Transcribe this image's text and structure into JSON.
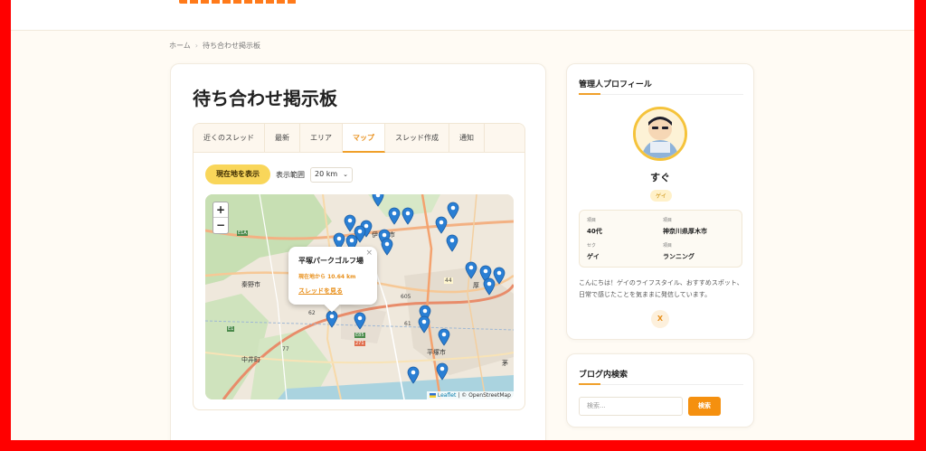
{
  "breadcrumb": {
    "home": "ホーム",
    "separator": "›",
    "current": "待ち合わせ掲示板"
  },
  "page": {
    "title": "待ち合わせ掲示板"
  },
  "tabs": [
    {
      "label": "近くのスレッド",
      "active": false
    },
    {
      "label": "最新",
      "active": false
    },
    {
      "label": "エリア",
      "active": false
    },
    {
      "label": "マップ",
      "active": true
    },
    {
      "label": "スレッド作成",
      "active": false
    },
    {
      "label": "通知",
      "active": false
    }
  ],
  "controls": {
    "show_location": "現在地を表示",
    "range_label": "表示範囲",
    "range_value": "20 km"
  },
  "map": {
    "zoom_in": "+",
    "zoom_out": "−",
    "labels": {
      "hadano": "秦野市",
      "nakai": "中井町",
      "hiratsuka": "平塚市",
      "road_605": "605",
      "road_44": "44",
      "road_62": "62",
      "road_61": "61",
      "road_e85": "E85",
      "road_271": "271",
      "road_e1a": "E1A",
      "road_77": "77",
      "road_e1": "E1",
      "road_63": "63",
      "isehara_fragment": "伊",
      "isehara_fragment2": "市",
      "atsugi_fragment": "厚",
      "chigasaki_fragment": "茅"
    },
    "popup": {
      "title": "平塚パークゴルフ場",
      "distance": "現在地から 10.64 km",
      "link": "スレッドを見る",
      "close": "×"
    },
    "attribution": {
      "leaflet": "Leaflet",
      "rest": "| © OpenStreetMap"
    },
    "marker_color": "#2a7fd4"
  },
  "profile": {
    "heading": "管理人プロフィール",
    "name": "すぐ",
    "badge": "ゲイ",
    "info": [
      {
        "key": "項目",
        "value": "40代"
      },
      {
        "key": "項目",
        "value": "神奈川県厚木市"
      },
      {
        "key": "セク",
        "value": "ゲイ"
      },
      {
        "key": "項目",
        "value": "ランニング"
      }
    ],
    "bio": "こんにちは！ゲイのライフスタイル、おすすめスポット、日常で感じたことを気ままに発信しています。",
    "social": "X"
  },
  "search": {
    "heading": "ブログ内検索",
    "placeholder": "検索...",
    "button": "検索"
  },
  "colors": {
    "accent": "#f0a02a",
    "button_yellow": "#f9d65a",
    "search_orange": "#f5900f",
    "frame_red": "#ff0000"
  }
}
